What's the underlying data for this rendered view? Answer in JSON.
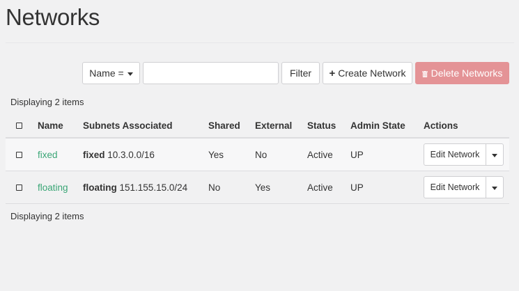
{
  "page": {
    "title": "Networks"
  },
  "toolbar": {
    "filter_field_label": "Name =",
    "filter_input_value": "",
    "filter_button": "Filter",
    "create_button": "Create Network",
    "delete_button": "Delete Networks"
  },
  "summary": {
    "top": "Displaying 2 items",
    "bottom": "Displaying 2 items"
  },
  "table": {
    "columns": [
      "Name",
      "Subnets Associated",
      "Shared",
      "External",
      "Status",
      "Admin State",
      "Actions"
    ],
    "rows": [
      {
        "name": "fixed",
        "subnet_name": "fixed",
        "subnet_cidr": "10.3.0.0/16",
        "shared": "Yes",
        "external": "No",
        "status": "Active",
        "admin_state": "UP",
        "action": "Edit Network"
      },
      {
        "name": "floating",
        "subnet_name": "floating",
        "subnet_cidr": "151.155.15.0/24",
        "shared": "No",
        "external": "Yes",
        "status": "Active",
        "admin_state": "UP",
        "action": "Edit Network"
      }
    ]
  },
  "colors": {
    "link": "#3aa676",
    "danger": "#e49396",
    "background": "#f1f1f2"
  },
  "icons": {
    "create": "plus-icon",
    "delete": "trash-icon",
    "dropdown": "caret-down-icon"
  }
}
